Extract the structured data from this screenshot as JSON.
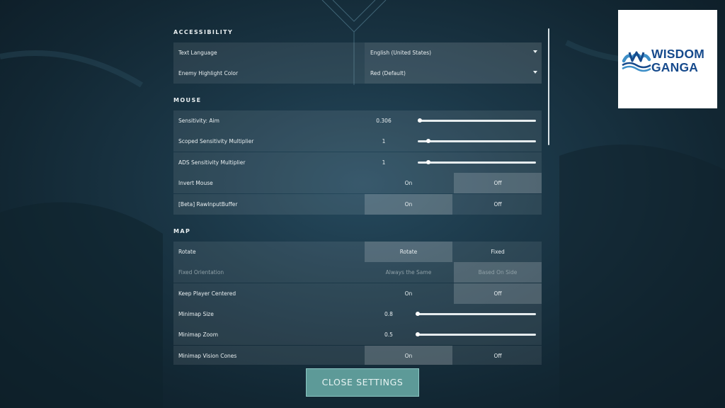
{
  "sections": {
    "accessibility": "ACCESSIBILITY",
    "mouse": "MOUSE",
    "map": "MAP"
  },
  "accessibility": {
    "text_language": {
      "label": "Text Language",
      "value": "English (United States)"
    },
    "enemy_highlight": {
      "label": "Enemy Highlight Color",
      "value": "Red (Default)"
    }
  },
  "mouse": {
    "sensitivity_aim": {
      "label": "Sensitivity: Aim",
      "value": "0.306",
      "level": 0.02
    },
    "scoped_multiplier": {
      "label": "Scoped Sensitivity Multiplier",
      "value": "1",
      "level": 0.09
    },
    "ads_multiplier": {
      "label": "ADS Sensitivity Multiplier",
      "value": "1",
      "level": 0.09
    },
    "invert_mouse": {
      "label": "Invert Mouse",
      "on": "On",
      "off": "Off",
      "selected": "off"
    },
    "raw_input": {
      "label": "[Beta] RawInputBuffer",
      "on": "On",
      "off": "Off",
      "selected": "on"
    }
  },
  "map": {
    "rotate": {
      "label": "Rotate",
      "opt1": "Rotate",
      "opt2": "Fixed",
      "selected": "opt1"
    },
    "fixed_orientation": {
      "label": "Fixed Orientation",
      "opt1": "Always the Same",
      "opt2": "Based On Side",
      "selected": "opt2"
    },
    "keep_centered": {
      "label": "Keep Player Centered",
      "on": "On",
      "off": "Off",
      "selected": "off"
    },
    "minimap_size": {
      "label": "Minimap Size",
      "value": "0.8",
      "level": 0.0
    },
    "minimap_zoom": {
      "label": "Minimap Zoom",
      "value": "0.5",
      "level": 0.0
    },
    "vision_cones": {
      "label": "Minimap Vision Cones",
      "on": "On",
      "off": "Off",
      "selected": "on"
    }
  },
  "close_button": "CLOSE SETTINGS",
  "logo": {
    "line1": "WISDOM",
    "line2": "GANGA"
  },
  "colors": {
    "accent": "#5d9a98",
    "logo_blue": "#164a8c",
    "background": "#1b3747"
  }
}
